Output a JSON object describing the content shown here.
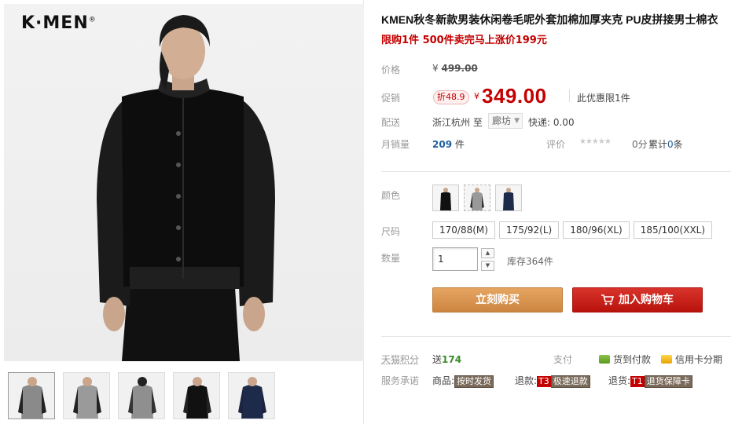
{
  "brand": {
    "logo_text": "K·MEN",
    "registered_mark": "®"
  },
  "gallery": {
    "thumbnails": [
      {
        "name": "grey-front"
      },
      {
        "name": "grey-side"
      },
      {
        "name": "grey-back"
      },
      {
        "name": "black-front"
      },
      {
        "name": "navy-front"
      }
    ]
  },
  "product": {
    "title": "KMEN秋冬新款男装休闲卷毛呢外套加棉加厚夹克 PU皮拼接男士棉衣",
    "subtitle": "限购1件 500件卖完马上涨价199元"
  },
  "price": {
    "label": "价格",
    "currency": "¥",
    "original": "499.00"
  },
  "promo": {
    "label": "促销",
    "discount_tag": "折48.9",
    "currency": "¥",
    "price": "349.00",
    "note": "此优惠限1件"
  },
  "shipping": {
    "label": "配送",
    "from": "浙江杭州 至",
    "to": "廊坊",
    "fee": "快递: 0.00"
  },
  "sales": {
    "label": "月销量",
    "count": "209",
    "unit": "件",
    "rating_label": "评价",
    "stars": "★★★★★",
    "score": "0分",
    "review_prefix": "累计",
    "review_count": "0",
    "review_suffix": "条"
  },
  "options": {
    "color_label": "颜色",
    "size_label": "尺码",
    "sizes": [
      "170/88(M)",
      "175/92(L)",
      "180/96(XL)",
      "185/100(XXL)"
    ],
    "qty_label": "数量",
    "qty_value": "1",
    "stock": "库存364件"
  },
  "actions": {
    "buy_now": "立刻购买",
    "add_to_cart": "加入购物车"
  },
  "footer": {
    "points_label": "天猫积分",
    "points_prefix": "送",
    "points_value": "174",
    "pay_label": "支付",
    "pay_cod": "货到付款",
    "pay_card": "信用卡分期",
    "service_label": "服务承诺",
    "svc_goods_prefix": "商品:",
    "svc_goods_tag": "按时发货",
    "svc_refund_prefix": "退款:",
    "svc_refund_badge": "T3",
    "svc_refund_tag": "极速退款",
    "svc_return_prefix": "退货:",
    "svc_return_badge": "T1",
    "svc_return_tag": "退货保障卡"
  },
  "colors": {
    "accent_red": "#c40000",
    "buy_orange": "#cc8540",
    "cart_red": "#b8120c",
    "link_blue": "#1f5f9f"
  }
}
